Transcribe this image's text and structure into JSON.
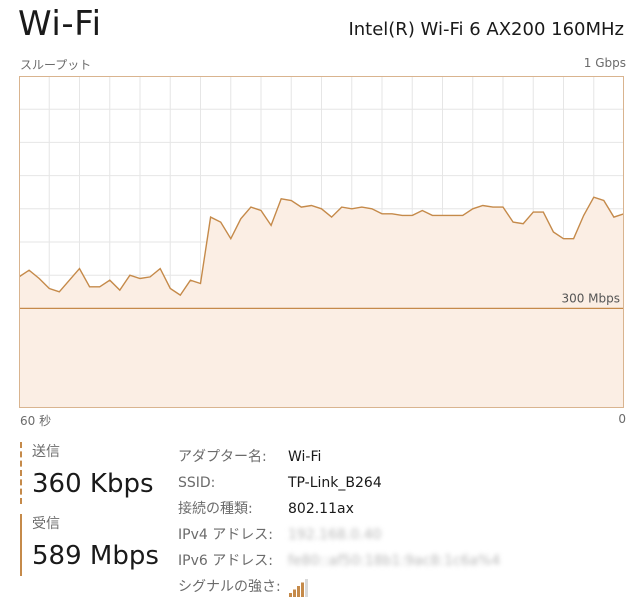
{
  "header": {
    "title": "Wi-Fi",
    "adapter": "Intel(R) Wi-Fi 6 AX200 160MHz"
  },
  "chart_data": {
    "type": "area",
    "title": "",
    "ylabel": "スループット",
    "ymax_label": "1 Gbps",
    "ylim": [
      0,
      1000
    ],
    "xlim": [
      60,
      0
    ],
    "x_axis_left": "60 秒",
    "x_axis_right": "0",
    "reference_line": {
      "value": 300,
      "label": "300 Mbps"
    },
    "grid": true,
    "colors": {
      "line": "#c58a4a",
      "fill": "#fbeee4",
      "grid": "#e6e6e6",
      "border": "#d9b48f"
    },
    "x": [
      60,
      59,
      58,
      57,
      56,
      55,
      54,
      53,
      52,
      51,
      50,
      49,
      48,
      47,
      46,
      45,
      44,
      43,
      42,
      41,
      40,
      39,
      38,
      37,
      36,
      35,
      34,
      33,
      32,
      31,
      30,
      29,
      28,
      27,
      26,
      25,
      24,
      23,
      22,
      21,
      20,
      19,
      18,
      17,
      16,
      15,
      14,
      13,
      12,
      11,
      10,
      9,
      8,
      7,
      6,
      5,
      4,
      3,
      2,
      1,
      0
    ],
    "series": [
      {
        "values": [
          395,
          415,
          390,
          360,
          350,
          385,
          420,
          365,
          365,
          385,
          355,
          400,
          390,
          395,
          420,
          360,
          340,
          385,
          375,
          575,
          560,
          510,
          570,
          605,
          595,
          550,
          630,
          625,
          605,
          610,
          600,
          575,
          605,
          600,
          605,
          600,
          585,
          585,
          580,
          580,
          595,
          580,
          580,
          580,
          580,
          600,
          610,
          605,
          605,
          560,
          555,
          590,
          590,
          530,
          510,
          510,
          580,
          635,
          625,
          575,
          585
        ]
      }
    ]
  },
  "stats": {
    "send": {
      "label": "送信",
      "value": "360 Kbps"
    },
    "receive": {
      "label": "受信",
      "value": "589 Mbps"
    }
  },
  "info": {
    "adapter_name_label": "アダプター名:",
    "adapter_name": "Wi-Fi",
    "ssid_label": "SSID:",
    "ssid": "TP-Link_B264",
    "conn_type_label": "接続の種類:",
    "conn_type": "802.11ax",
    "ipv4_label": "IPv4 アドレス:",
    "ipv4": "192.168.0.40",
    "ipv6_label": "IPv6 アドレス:",
    "ipv6": "fe80::af50:18b1:9ac8:1c6a%4",
    "signal_label": "シグナルの強さ:",
    "signal_icon": "signal-bars-icon",
    "signal_bars": 4,
    "signal_color": "#c58a4a"
  }
}
